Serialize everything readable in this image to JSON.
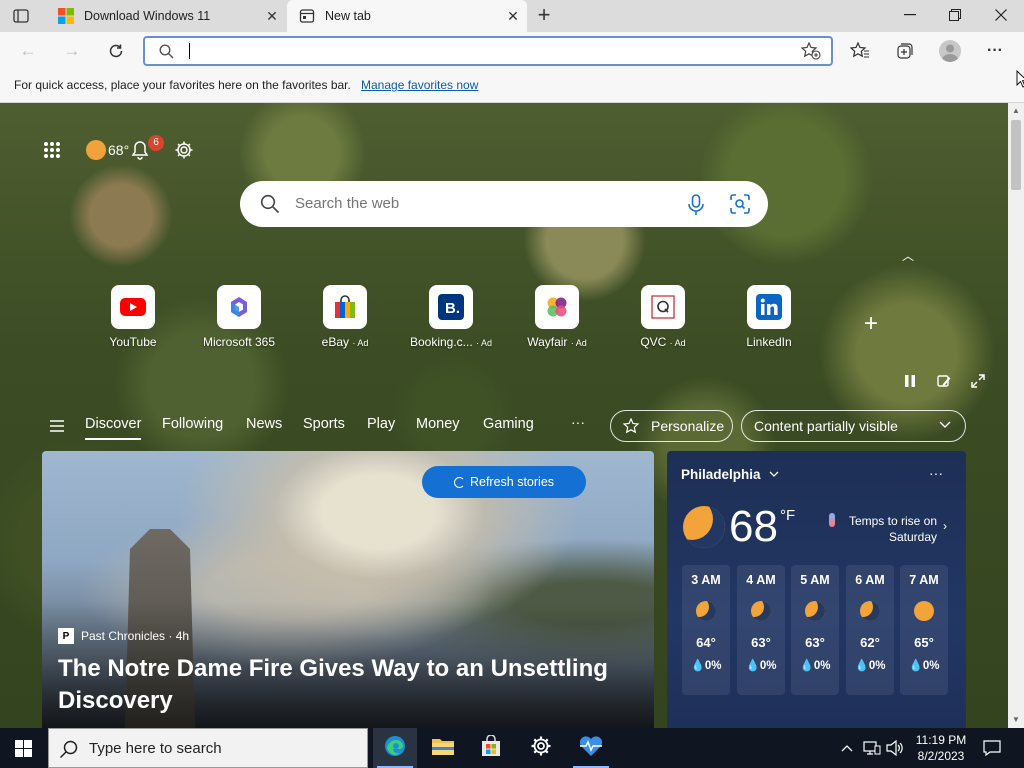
{
  "browser": {
    "tabs": [
      {
        "title": "Download Windows 11",
        "favicon": "windows-logo-icon",
        "active": false
      },
      {
        "title": "New tab",
        "favicon": "newtab-icon",
        "active": true
      }
    ],
    "address": {
      "value": "",
      "placeholder": ""
    },
    "favorites_bar": {
      "message": "For quick access, place your favorites here on the favorites bar.",
      "link": "Manage favorites now"
    }
  },
  "newtab": {
    "weather_chip": {
      "temp": "68°"
    },
    "notifications_count": "6",
    "search": {
      "placeholder": "Search the web"
    },
    "quick_links": [
      {
        "label": "YouTube",
        "ad": ""
      },
      {
        "label": "Microsoft 365",
        "ad": ""
      },
      {
        "label": "eBay",
        "ad": "· Ad"
      },
      {
        "label": "Booking.c...",
        "ad": "· Ad"
      },
      {
        "label": "Wayfair",
        "ad": "· Ad"
      },
      {
        "label": "QVC",
        "ad": "· Ad"
      },
      {
        "label": "LinkedIn",
        "ad": ""
      }
    ],
    "feed_tabs": [
      "Discover",
      "Following",
      "News",
      "Sports",
      "Play",
      "Money",
      "Gaming"
    ],
    "feed_more": "···",
    "personalize_label": "Personalize",
    "content_visibility": "Content partially visible",
    "hero": {
      "refresh_label": "Refresh stories",
      "source": "Past Chronicles · 4h",
      "headline": "The Notre Dame Fire Gives Way to an Unsettling Discovery"
    },
    "weather": {
      "city": "Philadelphia",
      "temp": "68",
      "unit": "°F",
      "note": "Temps to rise on Saturday",
      "hours": [
        {
          "time": "3 AM",
          "icon": "moon",
          "temp": "64°",
          "precip": "0%"
        },
        {
          "time": "4 AM",
          "icon": "moon",
          "temp": "63°",
          "precip": "0%"
        },
        {
          "time": "5 AM",
          "icon": "moon",
          "temp": "63°",
          "precip": "0%"
        },
        {
          "time": "6 AM",
          "icon": "moon",
          "temp": "62°",
          "precip": "0%"
        },
        {
          "time": "7 AM",
          "icon": "sun",
          "temp": "65°",
          "precip": "0%"
        }
      ]
    }
  },
  "taskbar": {
    "search_placeholder": "Type here to search",
    "time": "11:19 PM",
    "date": "8/2/2023"
  },
  "colors": {
    "accent": "#1570d3",
    "weather_bg": "#223764",
    "taskbar": "#0f1622"
  }
}
